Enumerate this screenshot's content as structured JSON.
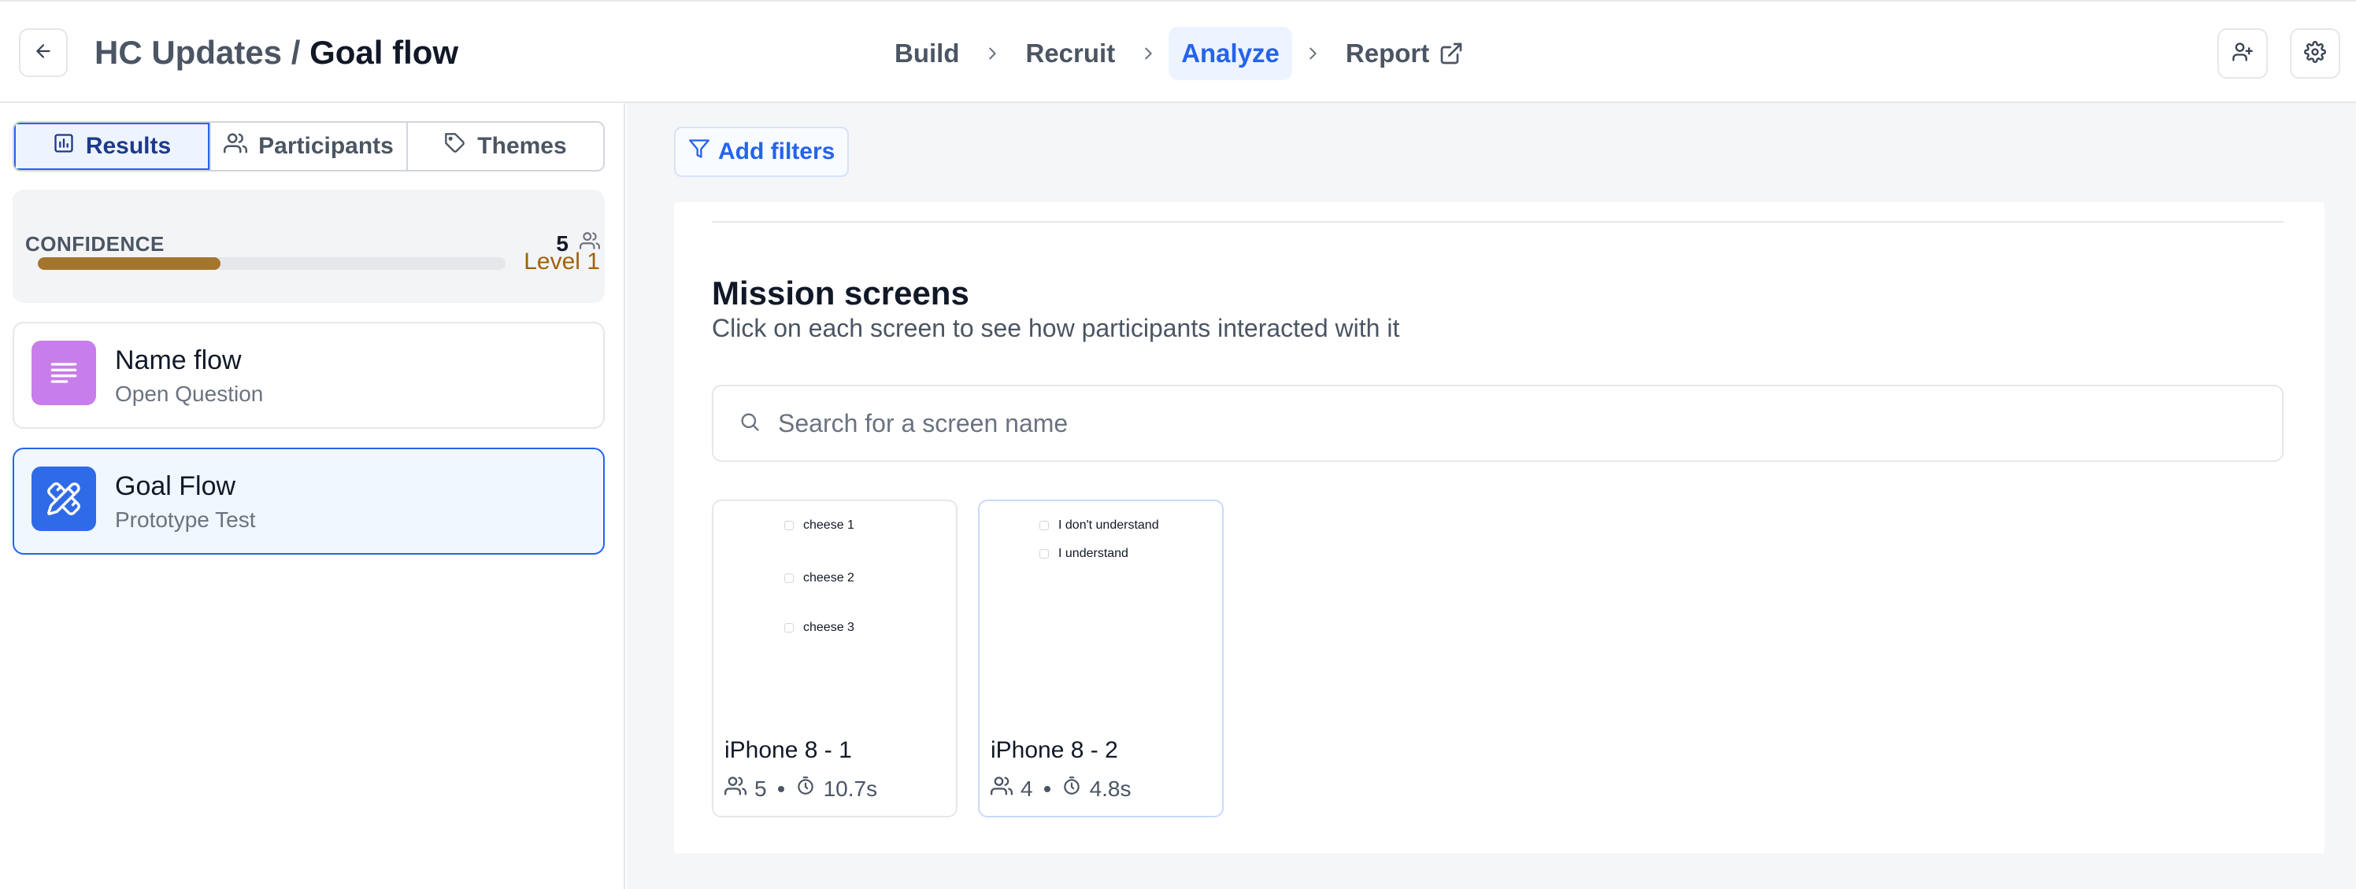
{
  "header": {
    "project": "HC Updates",
    "separator": "/",
    "page": "Goal flow",
    "steps": [
      {
        "label": "Build"
      },
      {
        "label": "Recruit"
      },
      {
        "label": "Analyze"
      },
      {
        "label": "Report"
      }
    ],
    "active_step": "Analyze"
  },
  "sidebar": {
    "tabs": [
      {
        "label": "Results",
        "icon": "bar-chart-icon"
      },
      {
        "label": "Participants",
        "icon": "users-icon"
      },
      {
        "label": "Themes",
        "icon": "tag-icon"
      }
    ],
    "active_tab": "Results",
    "confidence": {
      "label": "CONFIDENCE",
      "count": "5",
      "level": "Level 1",
      "progress": 0.39,
      "color": "#a3752d"
    },
    "blocks": [
      {
        "title": "Name flow",
        "subtitle": "Open Question",
        "icon": "text-lines-icon",
        "color": "#c77dea"
      },
      {
        "title": "Goal Flow",
        "subtitle": "Prototype Test",
        "icon": "prototype-pencil-ruler-icon",
        "color": "#2f6be6"
      }
    ],
    "selected_block": "Goal Flow"
  },
  "main": {
    "filters_label": "Add filters",
    "mission": {
      "title": "Mission screens",
      "subtitle": "Click on each screen to see how participants interacted with it",
      "search_placeholder": "Search for a screen name"
    },
    "screens": [
      {
        "name": "iPhone 8 - 1",
        "participants": "5",
        "time": "10.7s",
        "options": [
          "cheese 1",
          "cheese 2",
          "cheese 3"
        ]
      },
      {
        "name": "iPhone 8 - 2",
        "participants": "4",
        "time": "4.8s",
        "options": [
          "I don't understand",
          "I understand"
        ]
      }
    ]
  },
  "colors": {
    "accent": "#2563eb",
    "accent_bg": "#eef4ff"
  }
}
